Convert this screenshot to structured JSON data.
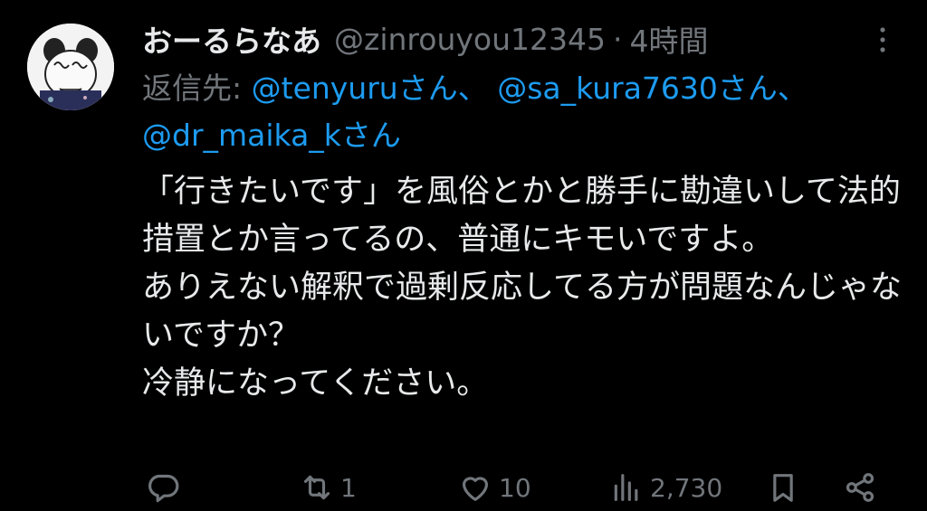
{
  "colors": {
    "background": "#000000",
    "text": "#e7e9ea",
    "muted": "#71767b",
    "link": "#1d9bf0"
  },
  "tweet": {
    "display_name": "おーるらなあ",
    "handle": "@zinrouyou12345",
    "separator": "·",
    "time": "4時間",
    "reply_to": {
      "prefix": "返信先:",
      "mentions": [
        {
          "handle": "@tenyuru",
          "suffix": "さん、"
        },
        {
          "handle": "@sa_kura7630",
          "suffix": "さん、"
        },
        {
          "handle": "@dr_maika_k",
          "suffix": "さん"
        }
      ]
    },
    "body_lines": [
      "「行きたいです」を風俗とかと勝手に勘違いして法的措置とか言ってるの、普通にキモいですよ。",
      "ありえない解釈で過剰反応してる方が問題なんじゃないですか？",
      "冷静になってください。"
    ]
  },
  "actions": {
    "reply": {
      "icon": "reply-icon",
      "count": ""
    },
    "repost": {
      "icon": "repost-icon",
      "count": "1"
    },
    "like": {
      "icon": "heart-icon",
      "count": "10"
    },
    "views": {
      "icon": "views-icon",
      "count": "2,730"
    },
    "bookmark": {
      "icon": "bookmark-icon"
    },
    "share": {
      "icon": "share-icon"
    }
  }
}
